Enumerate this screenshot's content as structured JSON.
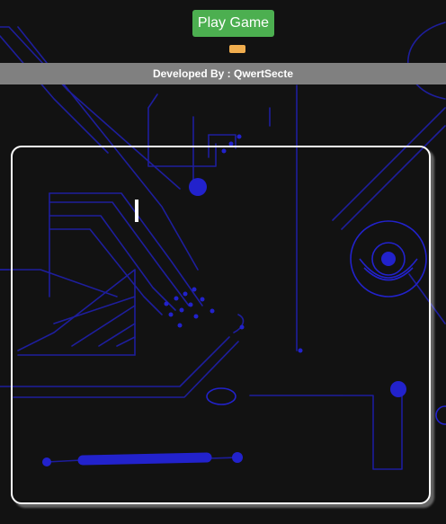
{
  "header": {
    "play_label": "Play Game"
  },
  "footer": {
    "credit": "Developed By : QwertSecte"
  },
  "colors": {
    "background": "#121212",
    "circuit": "#2222cc",
    "play_button": "#4caf50",
    "score_badge": "#f0ad4e",
    "credit_bar": "#808080",
    "board_border": "#ffffff",
    "paddle": "#ffffff"
  },
  "icons": {
    "background": "circuit-board-pattern",
    "player": "paddle"
  }
}
